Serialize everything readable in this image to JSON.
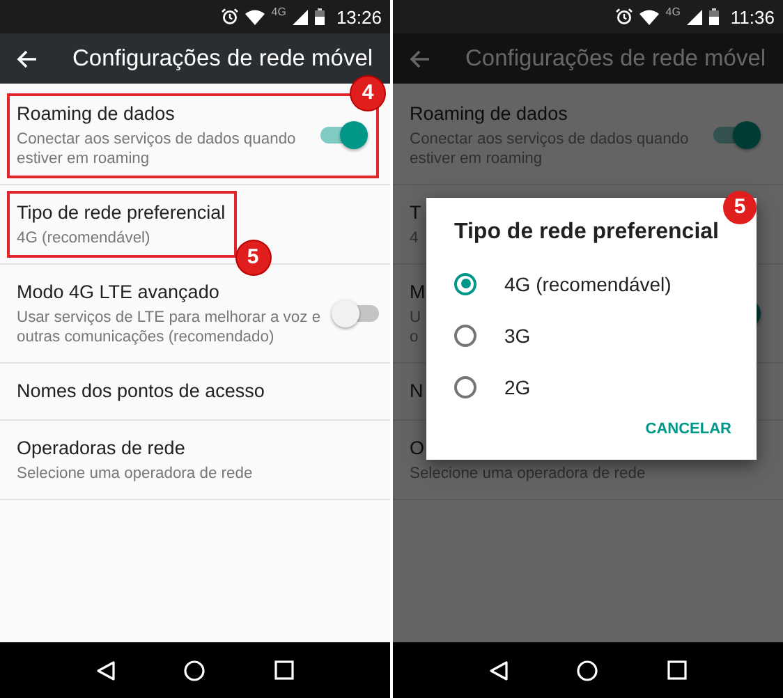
{
  "phones": [
    {
      "status_bar": {
        "network": "4G",
        "time": "13:26"
      },
      "app_bar": {
        "title": "Configurações de rede móvel"
      },
      "items": [
        {
          "kind": "toggle",
          "title": "Roaming de dados",
          "subtitle_lines": [
            "Conectar aos serviços de dados quando",
            "estiver em roaming"
          ],
          "on": true,
          "callout": {
            "number": "4",
            "kind": "row"
          }
        },
        {
          "kind": "text",
          "title": "Tipo de rede preferencial",
          "subtitle_lines": [
            "4G (recomendável)"
          ],
          "callout": {
            "number": "5",
            "kind": "text"
          }
        },
        {
          "kind": "toggle",
          "title": "Modo 4G LTE avançado",
          "subtitle_lines": [
            "Usar serviços de LTE para melhorar a voz e",
            "outras comunicações (recomendado)"
          ],
          "on": false
        },
        {
          "kind": "text",
          "title": "Nomes dos pontos de acesso"
        },
        {
          "kind": "text",
          "title": "Operadoras de rede",
          "subtitle_lines": [
            "Selecione uma operadora de rede"
          ]
        }
      ]
    },
    {
      "status_bar": {
        "network": "4G",
        "time": "11:36"
      },
      "app_bar": {
        "title": "Configurações de rede móvel"
      },
      "items": [
        {
          "kind": "toggle",
          "title": "Roaming de dados",
          "subtitle_lines": [
            "Conectar aos serviços de dados quando",
            "estiver em roaming"
          ],
          "on": true
        },
        {
          "kind": "text",
          "title": "T",
          "subtitle_lines": [
            "4"
          ]
        },
        {
          "kind": "toggle",
          "title": "M",
          "subtitle_lines": [
            "U",
            "o"
          ],
          "on": true
        },
        {
          "kind": "text",
          "title": "N"
        },
        {
          "kind": "text",
          "title": "O",
          "subtitle_lines": [
            "Selecione uma operadora de rede"
          ]
        }
      ],
      "dialog": {
        "title": "Tipo de rede preferencial",
        "options": [
          {
            "label": "4G (recomendável)",
            "selected": true
          },
          {
            "label": "3G",
            "selected": false
          },
          {
            "label": "2G",
            "selected": false
          }
        ],
        "button": "CANCELAR",
        "callout": {
          "number": "5"
        }
      }
    }
  ]
}
